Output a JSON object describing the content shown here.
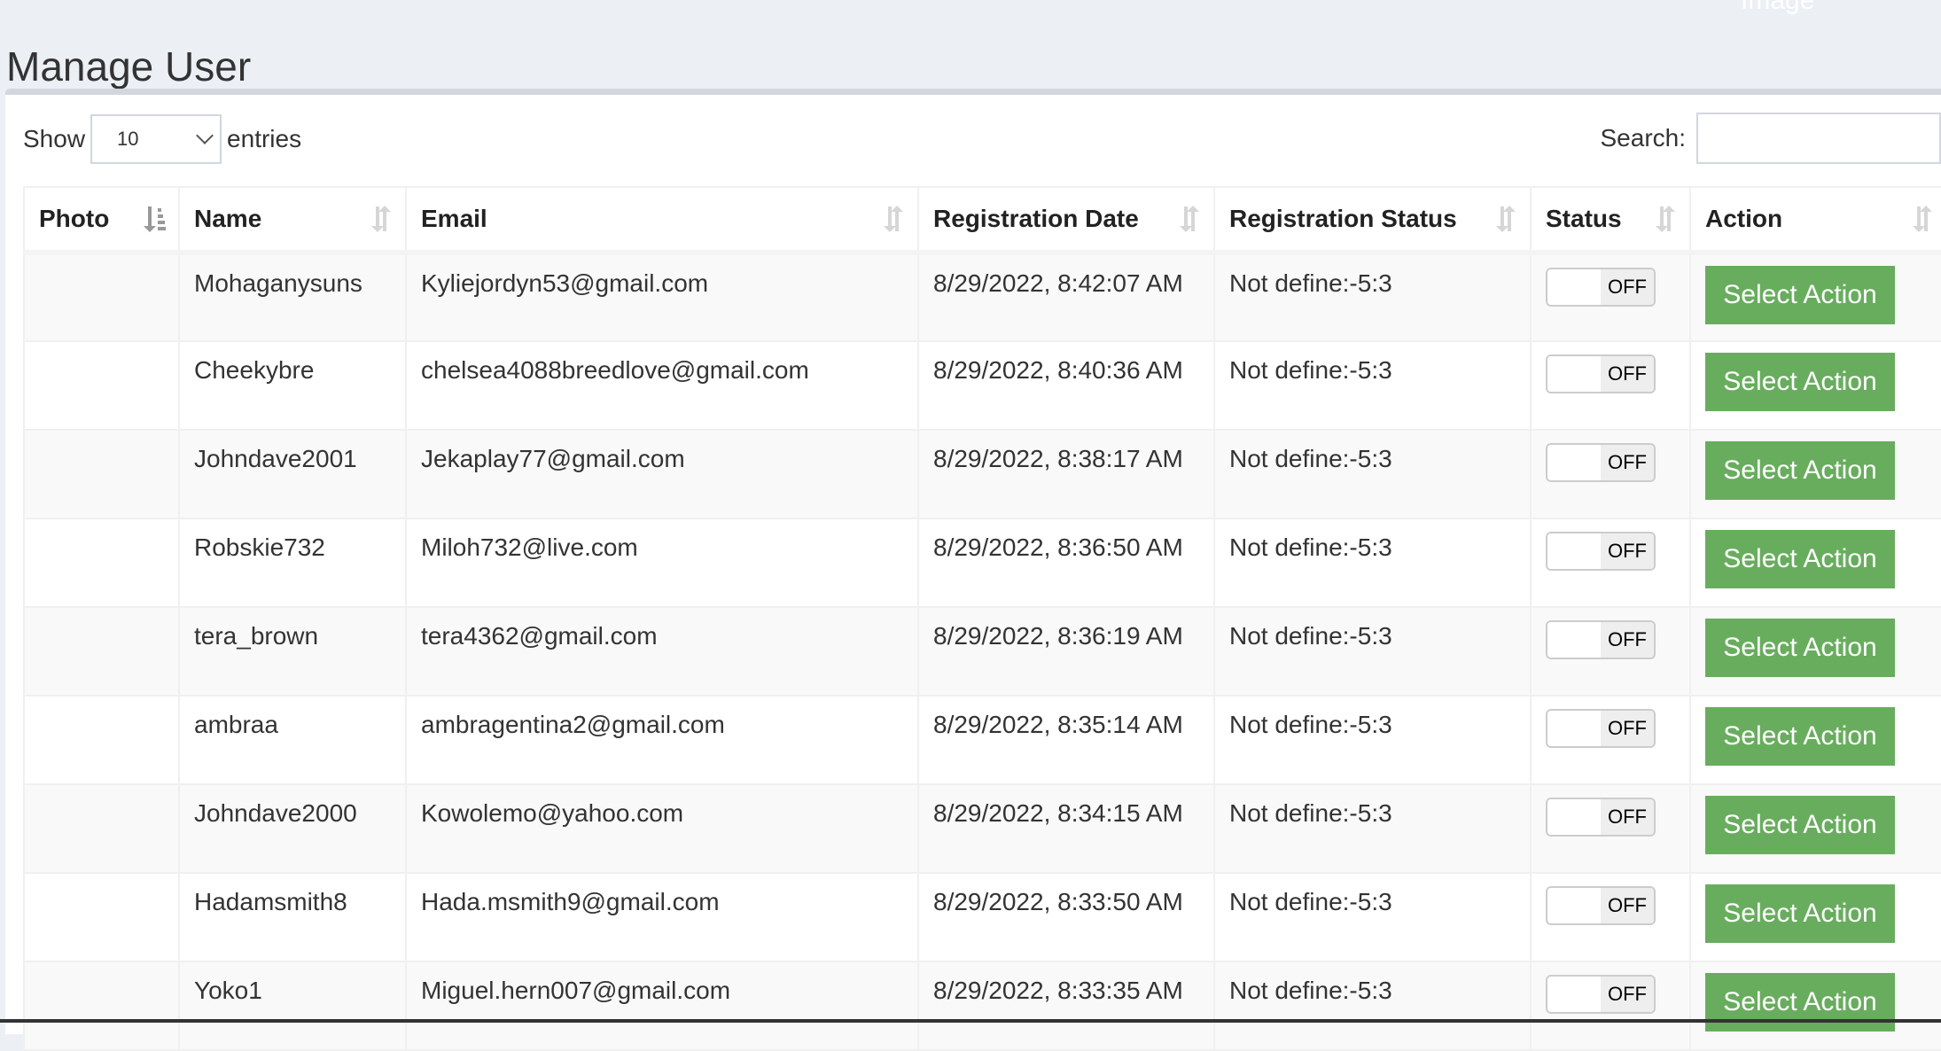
{
  "page": {
    "ghost_label": "Image",
    "title": "Manage User"
  },
  "controls": {
    "show_label": "Show",
    "entries_label": "entries",
    "page_size": "10",
    "search_label": "Search:",
    "search_value": "",
    "search_placeholder": ""
  },
  "table": {
    "columns": [
      {
        "key": "photo",
        "label": "Photo",
        "sort": "sorted-desc"
      },
      {
        "key": "name",
        "label": "Name",
        "sort": "sortable"
      },
      {
        "key": "email",
        "label": "Email",
        "sort": "sortable"
      },
      {
        "key": "registration_date",
        "label": "Registration Date",
        "sort": "sortable"
      },
      {
        "key": "registration_status",
        "label": "Registration Status",
        "sort": "sortable"
      },
      {
        "key": "status",
        "label": "Status",
        "sort": "sortable"
      },
      {
        "key": "action",
        "label": "Action",
        "sort": "sortable"
      }
    ],
    "rows": [
      {
        "photo": "",
        "name": "Mohaganysuns",
        "email": "Kyliejordyn53@gmail.com",
        "registration_date": "8/29/2022, 8:42:07 AM",
        "registration_status": "Not define:-5:3",
        "status": "OFF",
        "action": "Select Action"
      },
      {
        "photo": "",
        "name": "Cheekybre",
        "email": "chelsea4088breedlove@gmail.com",
        "registration_date": "8/29/2022, 8:40:36 AM",
        "registration_status": "Not define:-5:3",
        "status": "OFF",
        "action": "Select Action"
      },
      {
        "photo": "",
        "name": "Johndave2001",
        "email": "Jekaplay77@gmail.com",
        "registration_date": "8/29/2022, 8:38:17 AM",
        "registration_status": "Not define:-5:3",
        "status": "OFF",
        "action": "Select Action"
      },
      {
        "photo": "",
        "name": "Robskie732",
        "email": "Miloh732@live.com",
        "registration_date": "8/29/2022, 8:36:50 AM",
        "registration_status": "Not define:-5:3",
        "status": "OFF",
        "action": "Select Action"
      },
      {
        "photo": "",
        "name": "tera_brown",
        "email": "tera4362@gmail.com",
        "registration_date": "8/29/2022, 8:36:19 AM",
        "registration_status": "Not define:-5:3",
        "status": "OFF",
        "action": "Select Action"
      },
      {
        "photo": "",
        "name": "ambraa",
        "email": "ambragentina2@gmail.com",
        "registration_date": "8/29/2022, 8:35:14 AM",
        "registration_status": "Not define:-5:3",
        "status": "OFF",
        "action": "Select Action"
      },
      {
        "photo": "",
        "name": "Johndave2000",
        "email": "Kowolemo@yahoo.com",
        "registration_date": "8/29/2022, 8:34:15 AM",
        "registration_status": "Not define:-5:3",
        "status": "OFF",
        "action": "Select Action"
      },
      {
        "photo": "",
        "name": "Hadamsmith8",
        "email": "Hada.msmith9@gmail.com",
        "registration_date": "8/29/2022, 8:33:50 AM",
        "registration_status": "Not define:-5:3",
        "status": "OFF",
        "action": "Select Action"
      },
      {
        "photo": "",
        "name": "Yoko1",
        "email": "Miguel.hern007@gmail.com",
        "registration_date": "8/29/2022, 8:33:35 AM",
        "registration_status": "Not define:-5:3",
        "status": "OFF",
        "action": "Select Action"
      }
    ]
  },
  "colors": {
    "page_bg": "#ecf0f5",
    "card_border": "#d2d6de",
    "action_button": "#68ad5e",
    "row_stripe": "#f9f9f9"
  }
}
